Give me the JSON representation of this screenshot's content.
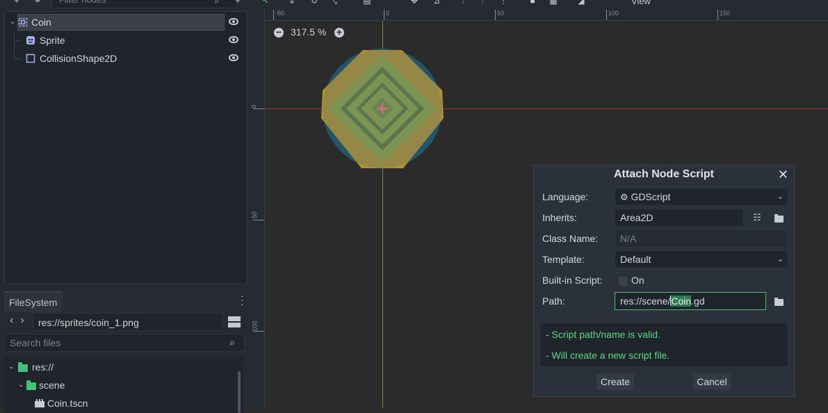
{
  "scene_panel": {
    "filter_placeholder": "Filter nodes",
    "nodes": [
      {
        "label": "Coin",
        "icon": "area2d-icon",
        "selected": true
      },
      {
        "label": "Sprite",
        "icon": "sprite-icon"
      },
      {
        "label": "CollisionShape2D",
        "icon": "collision-shape-icon"
      }
    ]
  },
  "filesystem": {
    "tab_label": "FileSystem",
    "current_path": "res://sprites/coin_1.png",
    "search_placeholder": "Search files",
    "tree": [
      {
        "label": "res://",
        "type": "folder"
      },
      {
        "label": "scene",
        "type": "folder"
      },
      {
        "label": "Coin.tscn",
        "type": "scene-file"
      }
    ]
  },
  "viewport": {
    "zoom_label": "317.5 %",
    "toolbar_view_label": "View",
    "ruler_top_labels": [
      "-50",
      "0",
      "50",
      "100",
      "150"
    ],
    "ruler_left_labels": [
      "0",
      "50",
      "100"
    ]
  },
  "dialog": {
    "title": "Attach Node Script",
    "language_label": "Language:",
    "language_value": "GDScript",
    "inherits_label": "Inherits:",
    "inherits_value": "Area2D",
    "class_name_label": "Class Name:",
    "class_name_placeholder": "N/A",
    "template_label": "Template:",
    "template_value": "Default",
    "builtin_label": "Built-in Script:",
    "builtin_toggle_label": "On",
    "path_label": "Path:",
    "path_prefix": "res://scene/",
    "path_highlight": "Coin",
    "path_suffix": ".gd",
    "status_lines": [
      "- Script path/name is valid.",
      "- Will create a new script file."
    ],
    "create_label": "Create",
    "cancel_label": "Cancel"
  },
  "colors": {
    "accent_green": "#5bdc82",
    "folder_green": "#3fc27b",
    "panel_bg": "#252a33",
    "dialog_bg": "#2b313b"
  }
}
